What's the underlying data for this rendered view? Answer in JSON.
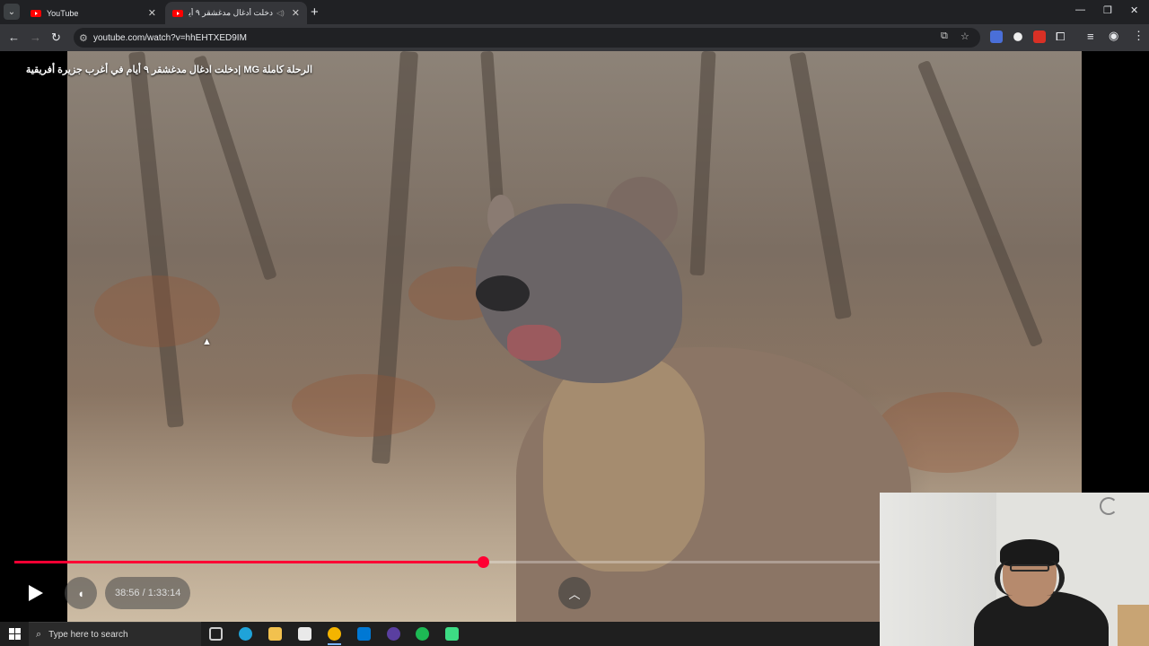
{
  "browser": {
    "tabs": [
      {
        "label": "YouTube",
        "active": false
      },
      {
        "label": "دخلت أدغال مدغشقر ٩ أيا",
        "active": true
      }
    ],
    "new_tab_glyph": "+",
    "window_controls": {
      "minimize": "—",
      "restore": "❐",
      "close": "✕"
    },
    "url": "youtube.com/watch?v=hhEHTXED9IM",
    "icons": [
      "back-icon",
      "forward-icon",
      "reload-icon",
      "site-info-icon",
      "install-icon",
      "bookmark-star-icon",
      "translate-icon",
      "extension-icon",
      "pdf-icon",
      "puzzle-icon",
      "reading-list-icon",
      "profile-icon",
      "menu-icon"
    ]
  },
  "video": {
    "title": "الرحلة كاملة MG |دخلت ادغال مدغشقر ٩ أيام في أغرب جزيرة أفريقية",
    "current_time": "38:56",
    "duration": "1:33:14",
    "time_text": "38:56 / 1:33:14",
    "progress_fraction": 0.418,
    "accent_color": "#ff0033"
  },
  "taskbar": {
    "search_placeholder": "Type here to search",
    "apps": [
      "task-view-icon",
      "edge-icon",
      "file-explorer-icon",
      "store-icon",
      "chrome-icon",
      "outlook-icon",
      "obs-icon",
      "spotify-icon",
      "android-studio-icon"
    ]
  }
}
